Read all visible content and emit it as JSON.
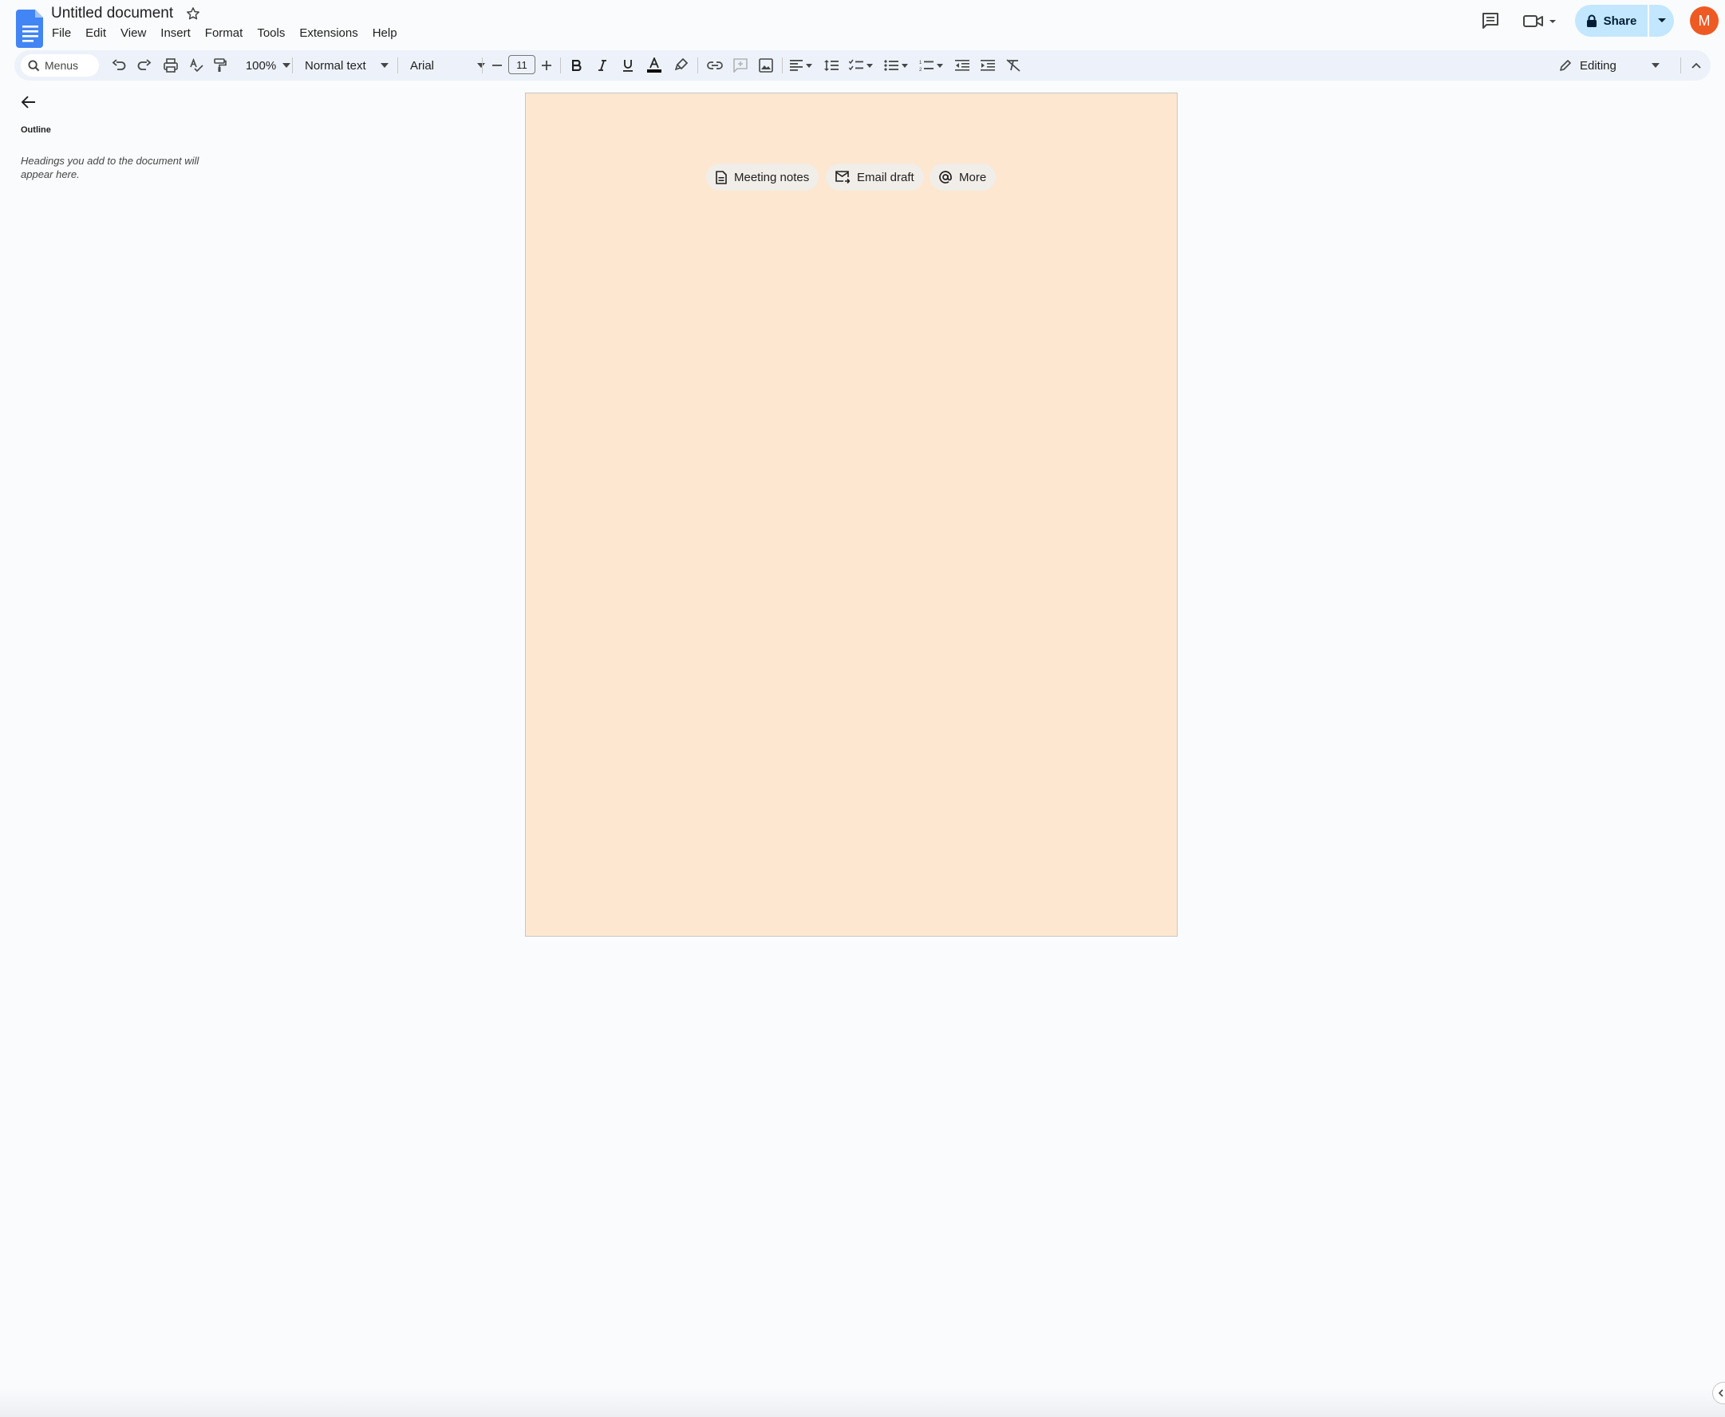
{
  "header": {
    "doc_title": "Untitled document",
    "menus": [
      "File",
      "Edit",
      "View",
      "Insert",
      "Format",
      "Tools",
      "Extensions",
      "Help"
    ],
    "share_label": "Share",
    "avatar_initial": "M"
  },
  "toolbar": {
    "search_label": "Menus",
    "zoom": "100%",
    "style": "Normal text",
    "font": "Arial",
    "font_size": "11",
    "mode": "Editing"
  },
  "outline": {
    "title": "Outline",
    "hint": "Headings you add to the document will appear here."
  },
  "document": {
    "chips": [
      "Meeting notes",
      "Email draft",
      "More"
    ],
    "page_color": "#fde7d0"
  },
  "colors": {
    "accent": "#0b57d0",
    "share_bg": "#c2e7ff",
    "avatar": "#ee5a24",
    "toolbar_bg": "#edf2fa"
  },
  "icons": [
    "docs-logo-icon",
    "star-icon",
    "comments-icon",
    "meet-icon",
    "lock-icon",
    "search-icon",
    "undo-icon",
    "redo-icon",
    "print-icon",
    "spellcheck-icon",
    "paint-format-icon",
    "bold-icon",
    "italic-icon",
    "underline-icon",
    "text-color-icon",
    "highlight-icon",
    "link-icon",
    "add-comment-icon",
    "image-icon",
    "align-icon",
    "line-spacing-icon",
    "checklist-icon",
    "bulleted-list-icon",
    "numbered-list-icon",
    "decrease-indent-icon",
    "increase-indent-icon",
    "clear-formatting-icon",
    "pencil-icon",
    "collapse-icon",
    "back-arrow-icon",
    "document-icon",
    "email-icon",
    "at-icon"
  ]
}
